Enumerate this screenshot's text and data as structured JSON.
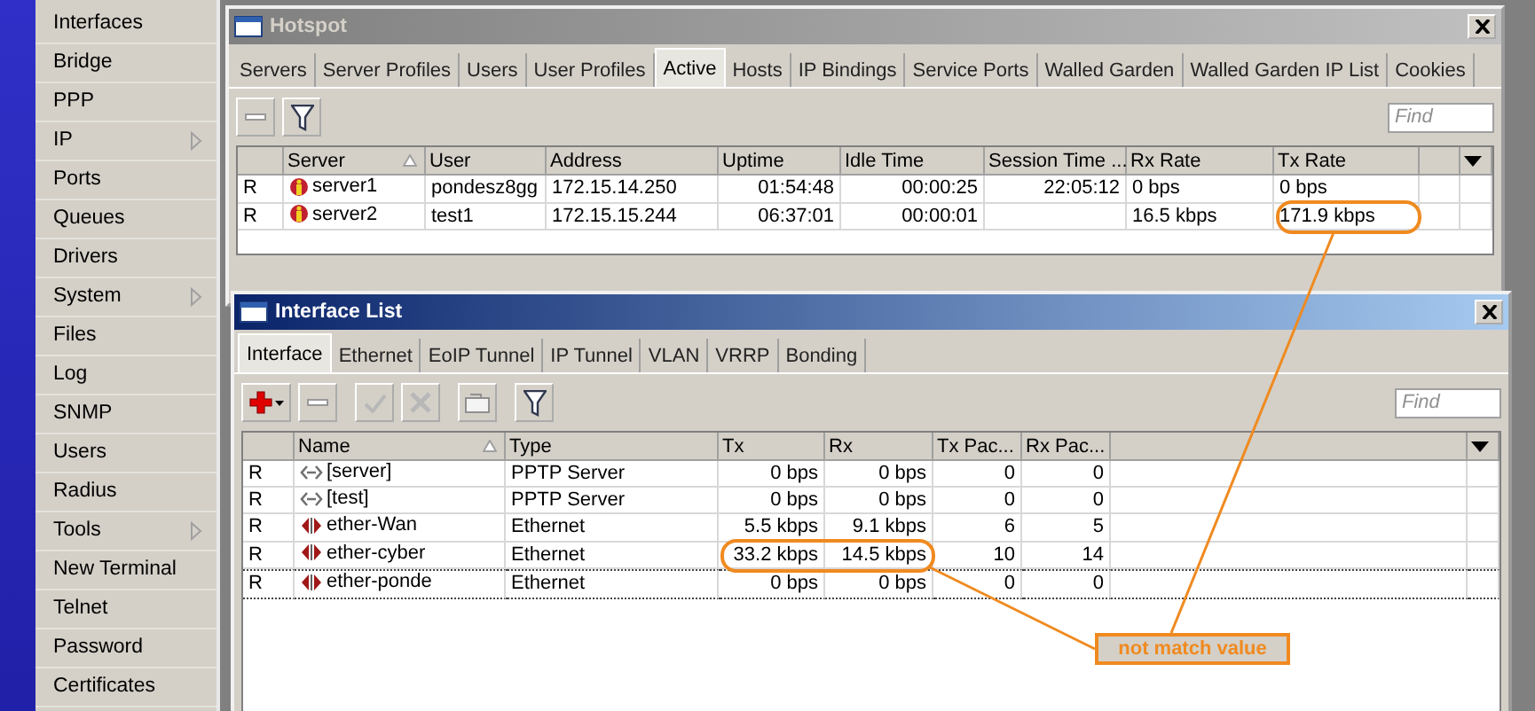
{
  "menu": [
    {
      "label": "Interfaces",
      "submenu": false
    },
    {
      "label": "Bridge",
      "submenu": false
    },
    {
      "label": "PPP",
      "submenu": false
    },
    {
      "label": "IP",
      "submenu": true
    },
    {
      "label": "Ports",
      "submenu": false
    },
    {
      "label": "Queues",
      "submenu": false
    },
    {
      "label": "Drivers",
      "submenu": false
    },
    {
      "label": "System",
      "submenu": true
    },
    {
      "label": "Files",
      "submenu": false
    },
    {
      "label": "Log",
      "submenu": false
    },
    {
      "label": "SNMP",
      "submenu": false
    },
    {
      "label": "Users",
      "submenu": false
    },
    {
      "label": "Radius",
      "submenu": false
    },
    {
      "label": "Tools",
      "submenu": true
    },
    {
      "label": "New Terminal",
      "submenu": false
    },
    {
      "label": "Telnet",
      "submenu": false
    },
    {
      "label": "Password",
      "submenu": false
    },
    {
      "label": "Certificates",
      "submenu": false
    }
  ],
  "hotspot_window": {
    "title": "Hotspot",
    "active": false,
    "tabs": [
      {
        "label": "Servers",
        "selected": false
      },
      {
        "label": "Server Profiles",
        "selected": false
      },
      {
        "label": "Users",
        "selected": false
      },
      {
        "label": "User Profiles",
        "selected": false
      },
      {
        "label": "Active",
        "selected": true
      },
      {
        "label": "Hosts",
        "selected": false
      },
      {
        "label": "IP Bindings",
        "selected": false
      },
      {
        "label": "Service Ports",
        "selected": false
      },
      {
        "label": "Walled Garden",
        "selected": false
      },
      {
        "label": "Walled Garden IP List",
        "selected": false
      },
      {
        "label": "Cookies",
        "selected": false
      }
    ],
    "find": {
      "placeholder": "Find"
    },
    "columns": [
      {
        "sorted": false
      },
      {
        "label": "Server",
        "sorted": true
      },
      {
        "label": "User",
        "sorted": false
      },
      {
        "label": "Address",
        "sorted": false
      },
      {
        "label": "Uptime",
        "sorted": false
      },
      {
        "label": "Idle Time",
        "sorted": false
      },
      {
        "label": "Session Time ...",
        "sorted": false
      },
      {
        "label": "Rx Rate",
        "sorted": false
      },
      {
        "label": "Tx Rate",
        "sorted": false
      }
    ],
    "rows": [
      {
        "flag": "R",
        "server": "server1",
        "user": "pondesz8gg",
        "address": "172.15.14.250",
        "uptime": "01:54:48",
        "idle_time": "00:00:25",
        "session_time": "22:05:12",
        "rx_rate": "0 bps",
        "tx_rate": "0 bps"
      },
      {
        "flag": "R",
        "server": "server2",
        "user": "test1",
        "address": "172.15.15.244",
        "uptime": "06:37:01",
        "idle_time": "00:00:01",
        "session_time": "",
        "rx_rate": "16.5 kbps",
        "tx_rate": "171.9 kbps",
        "circled": {
          "tx_rate": true
        }
      }
    ]
  },
  "interface_window": {
    "title": "Interface List",
    "active": true,
    "tabs": [
      {
        "label": "Interface",
        "selected": true
      },
      {
        "label": "Ethernet",
        "selected": false
      },
      {
        "label": "EoIP Tunnel",
        "selected": false
      },
      {
        "label": "IP Tunnel",
        "selected": false
      },
      {
        "label": "VLAN",
        "selected": false
      },
      {
        "label": "VRRP",
        "selected": false
      },
      {
        "label": "Bonding",
        "selected": false
      }
    ],
    "find": {
      "placeholder": "Find"
    },
    "columns": [
      {
        "sorted": false
      },
      {
        "label": "Name",
        "sorted": true
      },
      {
        "label": "Type",
        "sorted": false
      },
      {
        "label": "Tx",
        "sorted": false
      },
      {
        "label": "Rx",
        "sorted": false
      },
      {
        "label": "Tx Pac...",
        "sorted": false
      },
      {
        "label": "Rx Pac...",
        "sorted": false
      }
    ],
    "rows": [
      {
        "flag": "R",
        "kind": "pptp",
        "name": "[server]",
        "type": "PPTP Server",
        "tx": "0 bps",
        "rx": "0 bps",
        "tx_packets": "0",
        "rx_packets": "0",
        "focused": false
      },
      {
        "flag": "R",
        "kind": "pptp",
        "name": "[test]",
        "type": "PPTP Server",
        "tx": "0 bps",
        "rx": "0 bps",
        "tx_packets": "0",
        "rx_packets": "0",
        "focused": false
      },
      {
        "flag": "R",
        "kind": "ethernet",
        "name": "ether-Wan",
        "type": "Ethernet",
        "tx": "5.5 kbps",
        "rx": "9.1 kbps",
        "tx_packets": "6",
        "rx_packets": "5",
        "focused": false
      },
      {
        "flag": "R",
        "kind": "ethernet",
        "name": "ether-cyber",
        "type": "Ethernet",
        "tx": "33.2 kbps",
        "rx": "14.5 kbps",
        "tx_packets": "10",
        "rx_packets": "14",
        "focused": false,
        "circled": {
          "tx": true,
          "rx": true
        }
      },
      {
        "flag": "R",
        "kind": "ethernet",
        "name": "ether-ponde",
        "type": "Ethernet",
        "tx": "0 bps",
        "rx": "0 bps",
        "tx_packets": "0",
        "rx_packets": "0",
        "focused": true
      }
    ]
  },
  "annotation": {
    "label": "not match value"
  }
}
